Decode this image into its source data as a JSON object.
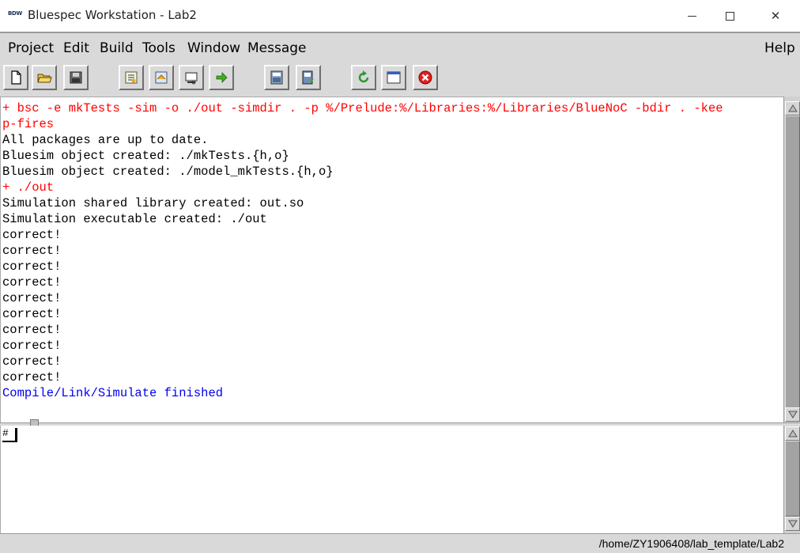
{
  "window": {
    "logo_text": "BDW",
    "title": "Bluespec Workstation  -  Lab2",
    "minimize_glyph": "",
    "close_glyph": "✕"
  },
  "menu": {
    "project": "Project",
    "edit": "Edit",
    "build": "Build",
    "tools": "Tools",
    "window": "Window",
    "message": "Message",
    "help": "Help"
  },
  "toolbar": {
    "buttons": [
      {
        "icon": "new-file-icon"
      },
      {
        "icon": "open-folder-icon"
      },
      {
        "icon": "save-icon"
      },
      {
        "icon": "compile-icon"
      },
      {
        "icon": "link-icon"
      },
      {
        "icon": "simulate-icon"
      },
      {
        "icon": "run-icon"
      },
      {
        "icon": "editor-icon"
      },
      {
        "icon": "project-files-icon"
      },
      {
        "icon": "refresh-icon"
      },
      {
        "icon": "window-icon"
      },
      {
        "icon": "stop-icon"
      }
    ]
  },
  "colors": {
    "command": "#ff0000",
    "normal": "#000000",
    "finished": "#0000ee"
  },
  "output": {
    "lines": [
      {
        "text": "+ bsc -e mkTests -sim -o ./out -simdir . -p %/Prelude:%/Libraries:%/Libraries/BlueNoC -bdir . -kee",
        "kind": "command"
      },
      {
        "text": "p-fires",
        "kind": "command"
      },
      {
        "text": "All packages are up to date.",
        "kind": "normal"
      },
      {
        "text": "Bluesim object created: ./mkTests.{h,o}",
        "kind": "normal"
      },
      {
        "text": "Bluesim object created: ./model_mkTests.{h,o}",
        "kind": "normal"
      },
      {
        "text": "+ ./out",
        "kind": "command"
      },
      {
        "text": "Simulation shared library created: out.so",
        "kind": "normal"
      },
      {
        "text": "Simulation executable created: ./out",
        "kind": "normal"
      },
      {
        "text": "correct!",
        "kind": "normal"
      },
      {
        "text": "correct!",
        "kind": "normal"
      },
      {
        "text": "correct!",
        "kind": "normal"
      },
      {
        "text": "correct!",
        "kind": "normal"
      },
      {
        "text": "correct!",
        "kind": "normal"
      },
      {
        "text": "correct!",
        "kind": "normal"
      },
      {
        "text": "correct!",
        "kind": "normal"
      },
      {
        "text": "correct!",
        "kind": "normal"
      },
      {
        "text": "correct!",
        "kind": "normal"
      },
      {
        "text": "correct!",
        "kind": "normal"
      },
      {
        "text": "Compile/Link/Simulate finished",
        "kind": "finished"
      }
    ]
  },
  "command": {
    "prompt": "#"
  },
  "status": {
    "path": "/home/ZY1906408/lab_template/Lab2"
  }
}
